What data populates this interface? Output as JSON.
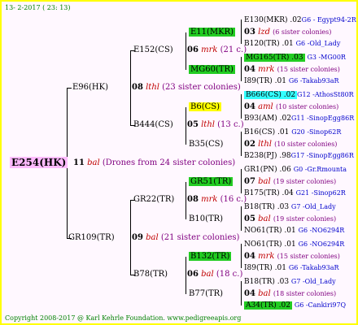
{
  "header": "13-  2-2017 ( 23: 13)",
  "footer": "Copyright 2008-2017 @ Karl Kehrle Foundation.   www.pedigreeapis.org",
  "root": {
    "id": "E254(HK)"
  },
  "drones_root": {
    "num": "11",
    "mark": "bal",
    "sis": "(Drones from 24 sister colonies)"
  },
  "l1": [
    {
      "id": "E96(HK)"
    },
    {
      "id": "GR109(TR)"
    }
  ],
  "l1_drones": [
    {
      "num": "08",
      "mark": "lthl",
      "sis": "(23 sister colonies)"
    },
    {
      "num": "09",
      "mark": "bal",
      "sis": "(21 sister colonies)"
    }
  ],
  "l2": [
    {
      "id": "E152(CS)"
    },
    {
      "id": "B444(CS)"
    },
    {
      "id": "GR22(TR)"
    },
    {
      "id": "B78(TR)"
    }
  ],
  "l2_drones": [
    {
      "num": "06",
      "mark": "mrk",
      "sis": "(21 c.)"
    },
    {
      "num": "05",
      "mark": "lthl",
      "sis": "(13 c.)"
    },
    {
      "num": "08",
      "mark": "mrk",
      "sis": "(16 c.)"
    },
    {
      "num": "06",
      "mark": "bal",
      "sis": "(18 c.)"
    }
  ],
  "l3": [
    {
      "id": "E11(MKR)"
    },
    {
      "id": "MG60(TR)"
    },
    {
      "id": "B6(CS)"
    },
    {
      "id": "B35(CS)"
    },
    {
      "id": "GR51(TR)"
    },
    {
      "id": "B10(TR)"
    },
    {
      "id": "B132(TR)"
    },
    {
      "id": "B77(TR)"
    }
  ],
  "l4": [
    {
      "top": "E130(MKR) .02",
      "top_src": "G6 - Egypt94-2R",
      "num": "03",
      "mark": "lzd",
      "sis": "(6 sister colonies)",
      "bot": "B120(TR) .01",
      "bot_src": "G6 -Old_Lady"
    },
    {
      "top": "MG165(TR) .03",
      "top_src": "G3 -MG00R",
      "num": "04",
      "mark": "mrk",
      "sis": "(15 sister colonies)",
      "bot": "I89(TR) .01",
      "bot_src": "G6 -Takab93aR"
    },
    {
      "top": "B666(CS) .02",
      "top_src": "G12 -AthosSt80R",
      "num": "04",
      "mark": "aml",
      "sis": "(10 sister colonies)",
      "bot": "B93(AM) .02",
      "bot_src": "G11 -SinopEgg86R"
    },
    {
      "top": "B16(CS) .01",
      "top_src": "G20 -Sinop62R",
      "num": "02",
      "mark": "lthl",
      "sis": "(10 sister colonies)",
      "bot": "B238(PJ) .98",
      "bot_src": "G17 -SinopEgg86R"
    },
    {
      "top": "GR1(PN) .06",
      "top_src": "G0 -Gr.Rmounta",
      "num": "07",
      "mark": "bal",
      "sis": "(19 sister colonies)",
      "bot": "B175(TR) .04",
      "bot_src": "G21 -Sinop62R"
    },
    {
      "top": "B18(TR) .03",
      "top_src": "G7 -Old_Lady",
      "num": "05",
      "mark": "bal",
      "sis": "(19 sister colonies)",
      "bot": "NO61(TR) .01",
      "bot_src": "G6 -NO6294R"
    },
    {
      "top": "NO61(TR) .01",
      "top_src": "G6 -NO6294R",
      "num": "04",
      "mark": "mrk",
      "sis": "(15 sister colonies)",
      "bot": "I89(TR) .01",
      "bot_src": "G6 -Takab93aR"
    },
    {
      "top": "B18(TR) .03",
      "top_src": "G7 -Old_Lady",
      "num": "04",
      "mark": "bal",
      "sis": "(18 sister colonies)",
      "bot": "A34(TR) .02",
      "bot_src": "G6 -Cankiri97Q"
    }
  ]
}
